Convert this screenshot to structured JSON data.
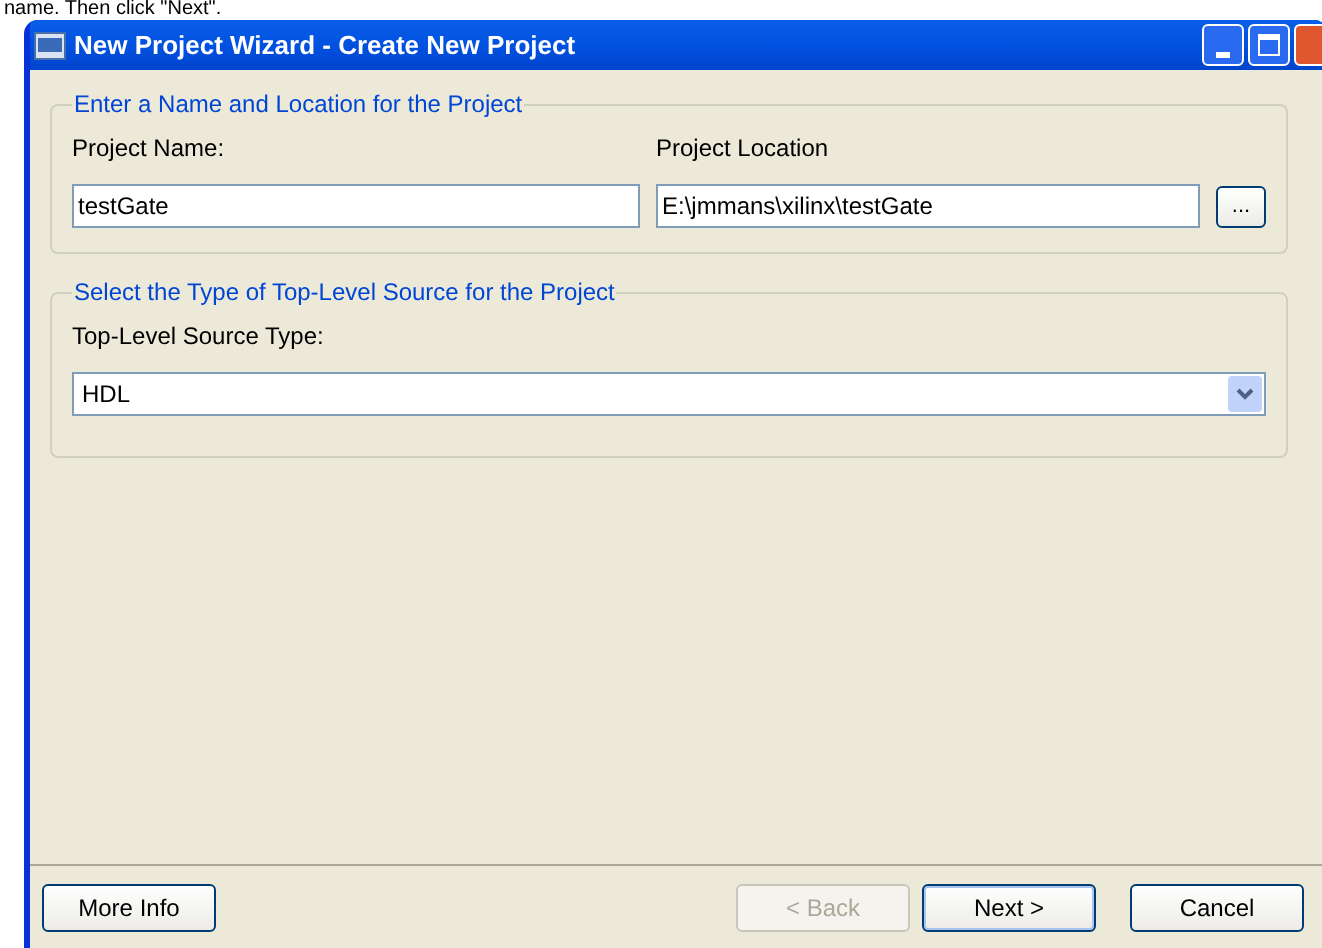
{
  "caption": "name. Then click \"Next\".",
  "window": {
    "title": "New Project Wizard - Create New Project"
  },
  "name_location_group": {
    "legend": "Enter a Name and Location for the Project",
    "project_name": {
      "label": "Project Name:",
      "value": "testGate"
    },
    "project_location": {
      "label": "Project Location",
      "value": "E:\\jmmans\\xilinx\\testGate",
      "browse": "..."
    }
  },
  "source_type_group": {
    "legend": "Select the Type of Top-Level Source for the Project",
    "label": "Top-Level Source Type:",
    "value": "HDL"
  },
  "buttons": [
    {
      "label": "More Info",
      "disabled": false,
      "default": false
    },
    {
      "label": "< Back",
      "disabled": true,
      "default": false
    },
    {
      "label": "Next >",
      "disabled": false,
      "default": true
    },
    {
      "label": "Cancel",
      "disabled": false,
      "default": false
    }
  ]
}
